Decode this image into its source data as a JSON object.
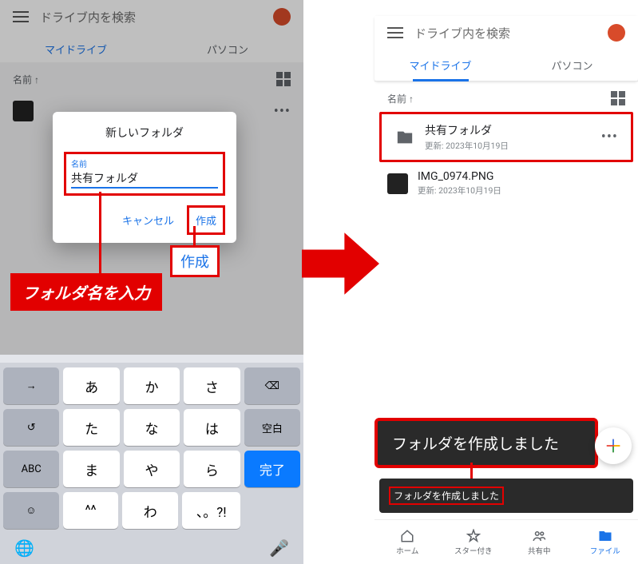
{
  "header": {
    "search_placeholder": "ドライブ内を検索"
  },
  "tabs": {
    "my_drive": "マイドライブ",
    "computers": "パソコン"
  },
  "list": {
    "sort_label": "名前 ↑"
  },
  "left_item": {
    "dots": "•••"
  },
  "dialog": {
    "title": "新しいフォルダ",
    "name_label": "名前",
    "name_value": "共有フォルダ",
    "cancel": "キャンセル",
    "create": "作成"
  },
  "callouts": {
    "create": "作成",
    "enter_name": "フォルダ名を入力"
  },
  "keyboard": {
    "rows": [
      [
        "→",
        "あ",
        "か",
        "さ"
      ],
      [
        "↺",
        "た",
        "な",
        "は",
        "空白"
      ],
      [
        "ABC",
        "ま",
        "や",
        "ら",
        "完了"
      ],
      [
        "☺",
        "^^",
        "わ",
        "、。?!"
      ]
    ],
    "backspace": "⌫",
    "globe": "🌐",
    "mic": "🎤"
  },
  "right_items": [
    {
      "name": "共有フォルダ",
      "sub": "更新: 2023年10月19日",
      "type": "folder"
    },
    {
      "name": "IMG_0974.PNG",
      "sub": "更新: 2023年10月19日",
      "type": "file"
    }
  ],
  "toast": {
    "big": "フォルダを作成しました",
    "small": "フォルダを作成しました"
  },
  "bottom_nav": {
    "home": "ホーム",
    "starred": "スター付き",
    "shared": "共有中",
    "files": "ファイル"
  }
}
